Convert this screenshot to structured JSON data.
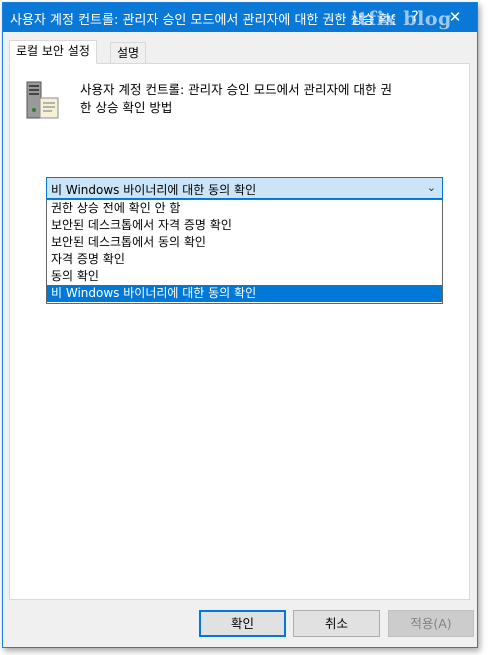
{
  "titlebar": {
    "title": "사용자 계정 컨트롤: 관리자 승인 모드에서 관리자에 대한 권한 상승 확인 방법 속성",
    "help_label": "?",
    "close_label": "✕",
    "watermark": "itfix blog"
  },
  "tabs": [
    {
      "label": "로컬 보안 설정"
    },
    {
      "label": "설명"
    }
  ],
  "policy": {
    "icon": "server-computer-icon",
    "description_line1": "사용자 계정 컨트롤: 관리자 승인 모드에서 관리자에 대한 권",
    "description_line2": "한 상승 확인 방법"
  },
  "combo": {
    "value": "비 Windows 바이너리에 대한 동의 확인",
    "arrow": "⌄"
  },
  "dropdown": {
    "options": [
      {
        "label": "권한 상승 전에 확인 안 함"
      },
      {
        "label": "보안된 데스크톱에서 자격 증명 확인"
      },
      {
        "label": "보안된 데스크톱에서 동의 확인"
      },
      {
        "label": "자격 증명 확인"
      },
      {
        "label": "동의 확인"
      },
      {
        "label": "비 Windows 바이너리에 대한 동의 확인"
      }
    ],
    "selected": "비 Windows 바이너리에 대한 동의 확인"
  },
  "buttons": {
    "ok": "확인",
    "cancel": "취소",
    "apply": "적용(A)"
  },
  "colors": {
    "accent": "#0078d7",
    "titlebar": "#0a78d7",
    "combo_bg": "#cce4f7"
  }
}
